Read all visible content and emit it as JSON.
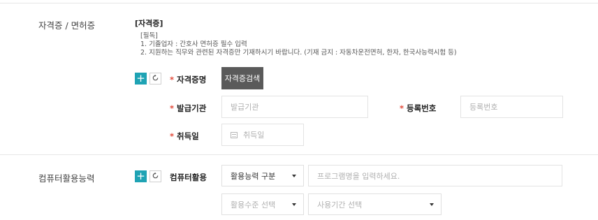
{
  "license": {
    "section_title": "자격증 / 면허증",
    "guide_title": "[자격증]",
    "guide_lines": [
      "[필독]",
      "1. 기졸업자 : 간호사 면허증 필수 입력",
      "2. 지원하는 직무와 관련된 자격증만 기재하시기 바랍니다. (기재 금지 : 자동차운전면허, 한자, 한국사능력시험 등)"
    ],
    "add_symbol": "+",
    "required_mark": "*",
    "cert_name_label": "자격증명",
    "search_button": "자격증검색",
    "issuer_label": "발급기관",
    "issuer_placeholder": "발급기관",
    "reg_no_label": "등록번호",
    "reg_no_placeholder": "등록번호",
    "acq_date_label": "취득일",
    "acq_date_placeholder": "취득일"
  },
  "computer": {
    "section_title": "컴퓨터활용능력",
    "add_symbol": "+",
    "usage_label": "컴퓨터활용",
    "category_select": "활용능력 구분",
    "program_placeholder": "프로그램명을 입력하세요.",
    "level_select": "활용수준 선택",
    "period_select": "사용기간 선택"
  },
  "colors": {
    "accent": "#1fa3b4",
    "required": "#e34a3a",
    "dark_button": "#5a5a5a"
  }
}
